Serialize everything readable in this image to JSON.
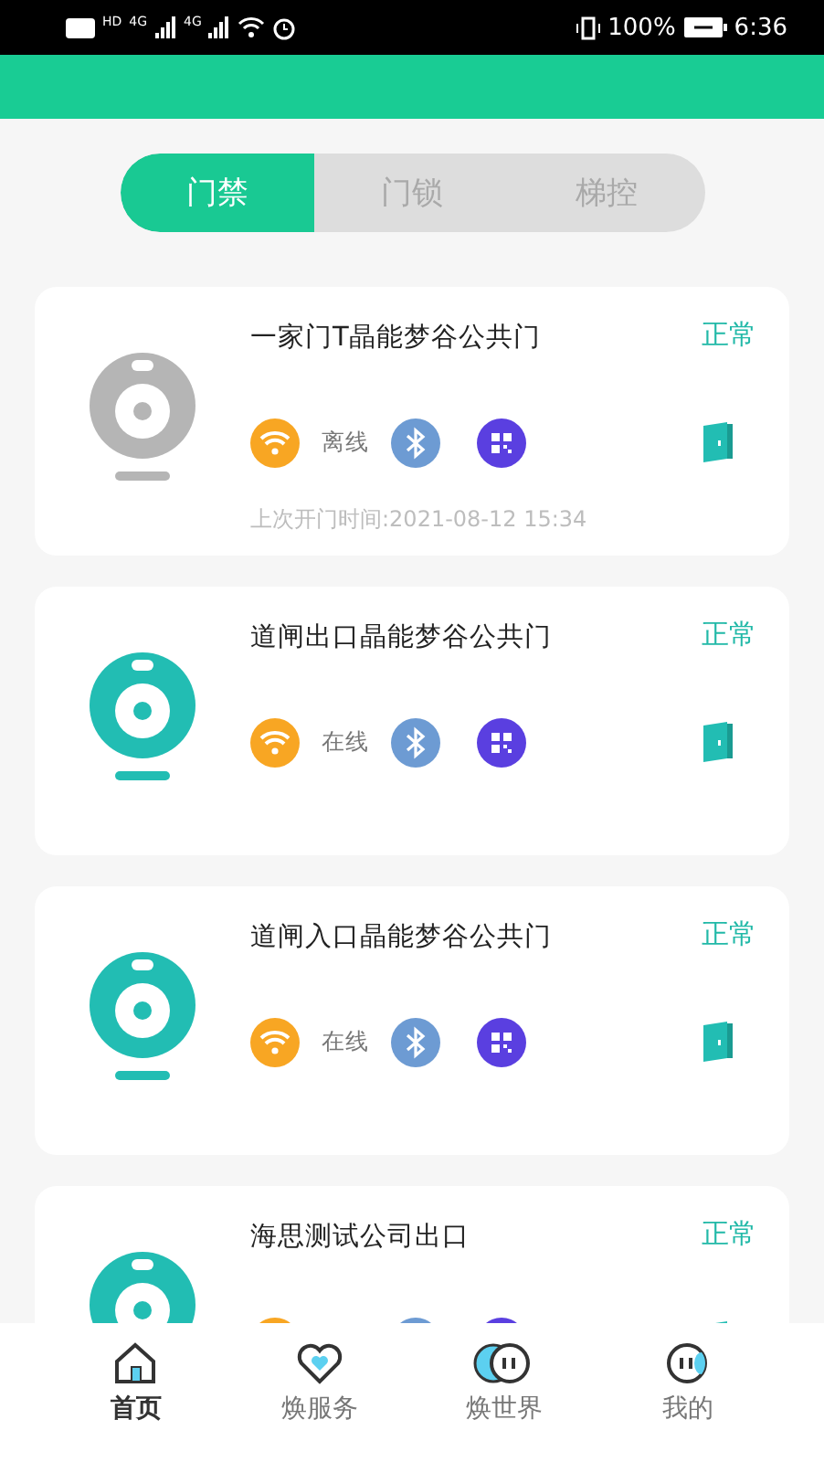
{
  "status_bar": {
    "hd": "HD",
    "signals": [
      "4G",
      "4G"
    ],
    "battery": "100%",
    "time": "6:36"
  },
  "tabs": [
    {
      "label": "门禁",
      "selected": true
    },
    {
      "label": "门锁",
      "selected": false
    },
    {
      "label": "梯控",
      "selected": false
    }
  ],
  "devices": [
    {
      "name": "一家门T晶能梦谷公共门",
      "status": "正常",
      "online": false,
      "connection": "离线",
      "last_open": "上次开门时间:2021-08-12 15:34"
    },
    {
      "name": "道闸出口晶能梦谷公共门",
      "status": "正常",
      "online": true,
      "connection": "在线"
    },
    {
      "name": "道闸入口晶能梦谷公共门",
      "status": "正常",
      "online": true,
      "connection": "在线"
    },
    {
      "name": "海思测试公司出口",
      "status": "正常",
      "online": true
    }
  ],
  "nav": [
    {
      "label": "首页",
      "selected": true,
      "kind": "home"
    },
    {
      "label": "焕服务",
      "selected": false,
      "kind": "heart"
    },
    {
      "label": "焕世界",
      "selected": false,
      "kind": "world"
    },
    {
      "label": "我的",
      "selected": false,
      "kind": "me"
    }
  ]
}
